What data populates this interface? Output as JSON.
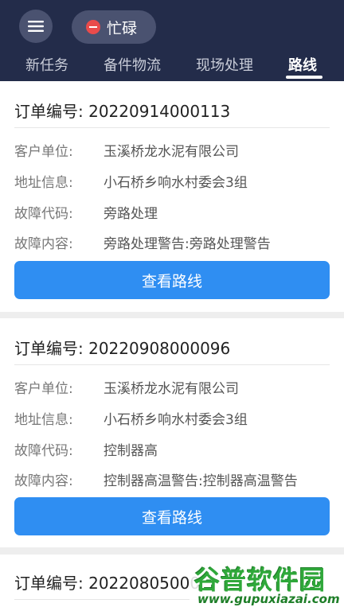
{
  "header": {
    "status_text": "忙碌",
    "tabs": [
      {
        "label": "新任务",
        "active": false
      },
      {
        "label": "备件物流",
        "active": false
      },
      {
        "label": "现场处理",
        "active": false
      },
      {
        "label": "路线",
        "active": true
      }
    ]
  },
  "labels": {
    "order_no": "订单编号:",
    "customer": "客户单位:",
    "address": "地址信息:",
    "fault_code": "故障代码:",
    "fault_content": "故障内容:"
  },
  "orders": [
    {
      "order_no": "20220914000113",
      "customer": "玉溪桥龙水泥有限公司",
      "address": "小石桥乡响水村委会3组",
      "fault_code": "旁路处理",
      "fault_content": "旁路处理警告:旁路处理警告",
      "button": "查看路线"
    },
    {
      "order_no": "20220908000096",
      "customer": "玉溪桥龙水泥有限公司",
      "address": "小石桥乡响水村委会3组",
      "fault_code": "控制器高",
      "fault_content": "控制器高温警告:控制器高温警告",
      "button": "查看路线"
    },
    {
      "order_no": "20220805000"
    }
  ],
  "watermark": {
    "logo": "谷普软件园",
    "url": "www.gupuxiazai.com"
  },
  "colors": {
    "header_bg": "#232c4a",
    "accent": "#2f8ef2",
    "busy_dot": "#e94b4b"
  }
}
